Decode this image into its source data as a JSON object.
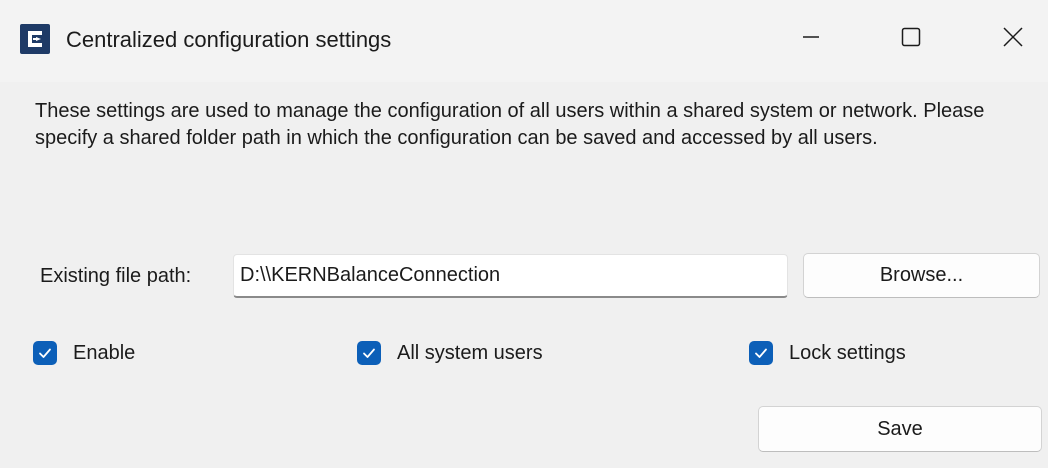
{
  "window": {
    "title": "Centralized configuration settings",
    "controls": {
      "minimize": "minimize-icon",
      "maximize": "maximize-icon",
      "close": "close-icon"
    }
  },
  "description": "These settings are used to manage the configuration of all users within a shared system or network. Please specify a shared folder path in which the configuration can be saved and accessed by all users.",
  "path": {
    "label": "Existing file path:",
    "value": "D:\\\\KERNBalanceConnection"
  },
  "buttons": {
    "browse": "Browse...",
    "save": "Save"
  },
  "checkboxes": {
    "enable": {
      "label": "Enable",
      "checked": true
    },
    "all_users": {
      "label": "All system users",
      "checked": true
    },
    "lock": {
      "label": "Lock settings",
      "checked": true
    }
  },
  "colors": {
    "accent": "#0c5fb8",
    "icon_bg": "#1e3a66",
    "window_bg": "#f0f0f0"
  }
}
